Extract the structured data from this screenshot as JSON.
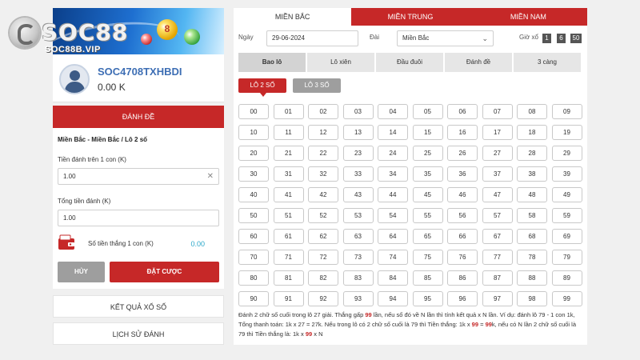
{
  "brand": {
    "name": "SOC88",
    "site": "SOC88B.VIP"
  },
  "banner": {
    "ball_number": "8"
  },
  "user": {
    "username": "SOC4708TXHBDI",
    "balance": "0.00 K"
  },
  "bet_panel": {
    "header": "ĐÁNH ĐỀ",
    "breadcrumb": "Miền Bắc - Miền Bắc / Lô 2 số",
    "stake_label": "Tiền đánh trên 1 con (K)",
    "stake_value": "1.00",
    "total_label": "Tổng tiền đánh (K)",
    "total_value": "1.00",
    "win_label": "Số tiền thắng 1 con (K)",
    "win_value": "0.00",
    "cancel_label": "HỦY",
    "submit_label": "ĐẶT CƯỢC"
  },
  "side_links": [
    "KẾT QUẢ XỔ SỐ",
    "LỊCH SỬ ĐÁNH"
  ],
  "region_tabs": [
    {
      "label": "MIỀN BẮC",
      "active": true
    },
    {
      "label": "MIỀN TRUNG",
      "active": false
    },
    {
      "label": "MIỀN NAM",
      "active": false
    }
  ],
  "filters": {
    "date_label": "Ngày",
    "date_value": "29-06-2024",
    "region_label": "Đài",
    "region_value": "Miền Bắc",
    "clock_label": "Giờ xổ",
    "clock_values": [
      "1",
      "6",
      "50"
    ]
  },
  "type_tabs": [
    {
      "label": "Bao lô",
      "active": true
    },
    {
      "label": "Lô xiên",
      "active": false
    },
    {
      "label": "Đầu đuôi",
      "active": false
    },
    {
      "label": "Đánh đề",
      "active": false
    },
    {
      "label": "3 càng",
      "active": false
    }
  ],
  "sub_tabs": [
    {
      "label": "LÔ 2 SỐ",
      "active": true
    },
    {
      "label": "LÔ 3 SỐ",
      "active": false
    }
  ],
  "numbers": [
    "00",
    "01",
    "02",
    "03",
    "04",
    "05",
    "06",
    "07",
    "08",
    "09",
    "10",
    "11",
    "12",
    "13",
    "14",
    "15",
    "16",
    "17",
    "18",
    "19",
    "20",
    "21",
    "22",
    "23",
    "24",
    "25",
    "26",
    "27",
    "28",
    "29",
    "30",
    "31",
    "32",
    "33",
    "34",
    "35",
    "36",
    "37",
    "38",
    "39",
    "40",
    "41",
    "42",
    "43",
    "44",
    "45",
    "46",
    "47",
    "48",
    "49",
    "50",
    "51",
    "52",
    "53",
    "54",
    "55",
    "56",
    "57",
    "58",
    "59",
    "60",
    "61",
    "62",
    "63",
    "64",
    "65",
    "66",
    "67",
    "68",
    "69",
    "70",
    "71",
    "72",
    "73",
    "74",
    "75",
    "76",
    "77",
    "78",
    "79",
    "80",
    "81",
    "82",
    "83",
    "84",
    "85",
    "86",
    "87",
    "88",
    "89",
    "90",
    "91",
    "92",
    "93",
    "94",
    "95",
    "96",
    "97",
    "98",
    "99"
  ],
  "note": {
    "p1": "Đánh 2 chữ số cuối trong lô 27 giải. Thắng gấp ",
    "h1": "99",
    "p2": " lần, nếu số đó về N lần thì tính kết quả x N lần. Ví dụ: đánh lô 79 - 1 con 1k, Tổng thanh toán: 1k x 27 = 27k. Nếu trong lô có 2 chữ số cuối là 79 thì Tiền thắng: 1k x ",
    "h2": "99",
    "p3": " = ",
    "h3": "99",
    "p4": "k, nếu có N lần 2 chữ số cuối là 79 thì Tiền thắng là: 1k x ",
    "h4": "99",
    "p5": " x N"
  },
  "colors": {
    "accent": "#c62828",
    "username": "#3d6eb4",
    "win_value": "#2aa7c9"
  }
}
